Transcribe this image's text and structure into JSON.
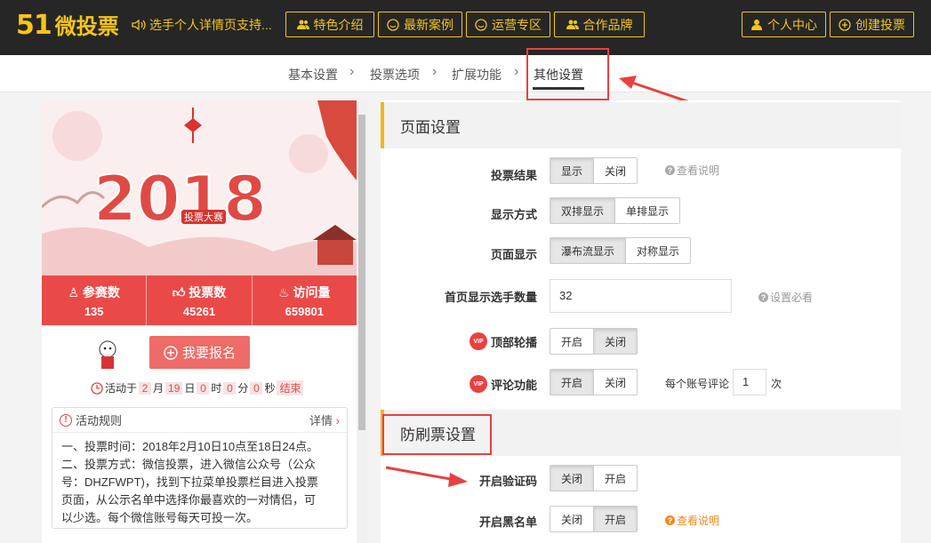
{
  "header": {
    "logo_num": "51",
    "logo_text": "微投票",
    "tagline": "选手个人详情页支持...",
    "nav": [
      "特色介绍",
      "最新案例",
      "运营专区",
      "合作品牌"
    ],
    "user_center": "个人中心",
    "create_vote": "创建投票"
  },
  "breadcrumb": [
    "基本设置",
    "投票选项",
    "扩展功能",
    "其他设置"
  ],
  "preview": {
    "banner_year": "2018",
    "banner_badge": "投票大赛",
    "stats": [
      {
        "label": "参赛数",
        "value": "135"
      },
      {
        "label": "投票数",
        "value": "45261"
      },
      {
        "label": "访问量",
        "value": "659801"
      }
    ],
    "signup_label": "我要报名",
    "countdown": {
      "prefix": "活动于",
      "month": "2",
      "month_u": "月",
      "day": "19",
      "day_u": "日",
      "hour": "0",
      "hour_u": "时",
      "min": "0",
      "min_u": "分",
      "sec": "0",
      "sec_u": "秒",
      "status": "结束"
    },
    "rules": {
      "title": "活动规则",
      "detail": "详情",
      "lines": [
        "一、投票时间：2018年2月10日10点至18日24点。",
        "二、投票方式：微信投票，进入微信公众号（公众",
        "号：DHZFWPT)，找到下拉菜单投票栏目进入投票",
        "页面，从公示名单中选择你最喜欢的一对情侣，可",
        "以少选。每个微信账号每天可投一次。"
      ]
    }
  },
  "settings": {
    "page_section": "页面设置",
    "vote_result": {
      "label": "投票结果",
      "options": [
        "显示",
        "关闭"
      ],
      "help": "查看说明"
    },
    "display_mode": {
      "label": "显示方式",
      "options": [
        "双排显示",
        "单排显示"
      ]
    },
    "page_display": {
      "label": "页面显示",
      "options": [
        "瀑布流显示",
        "对称显示"
      ]
    },
    "home_count": {
      "label": "首页显示选手数量",
      "value": "32",
      "help": "设置必看"
    },
    "top_carousel": {
      "label": "顶部轮播",
      "options": [
        "开启",
        "关闭"
      ]
    },
    "comments": {
      "label": "评论功能",
      "options": [
        "开启",
        "关闭"
      ],
      "per_account": "每个账号评论",
      "count": "1",
      "unit": "次"
    },
    "anti_section": "防刷票设置",
    "captcha": {
      "label": "开启验证码",
      "options": [
        "关闭",
        "开启"
      ]
    },
    "blacklist": {
      "label": "开启黑名单",
      "options": [
        "关闭",
        "开启"
      ],
      "help": "查看说明"
    }
  },
  "colors": {
    "accent": "#f5c518",
    "red": "#e8413f",
    "stats_bg": "#ea4a47"
  }
}
